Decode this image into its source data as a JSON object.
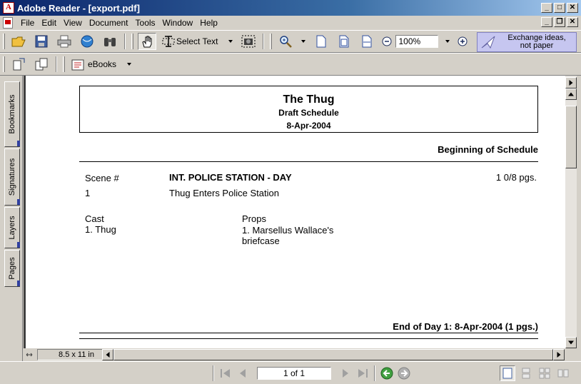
{
  "window": {
    "title": "Adobe Reader - [export.pdf]",
    "controls": {
      "minimize": "_",
      "maximize": "□",
      "close": "✕",
      "restore": "❐"
    }
  },
  "menu": {
    "items": [
      {
        "label": "File"
      },
      {
        "label": "Edit"
      },
      {
        "label": "View"
      },
      {
        "label": "Document"
      },
      {
        "label": "Tools"
      },
      {
        "label": "Window"
      },
      {
        "label": "Help"
      }
    ]
  },
  "toolbar": {
    "select_text_label": "Select Text",
    "zoom_value": "100%",
    "exchange_line1": "Exchange ideas,",
    "exchange_line2": "not paper",
    "ebooks_label": "eBooks"
  },
  "nav_tabs": [
    {
      "label": "Bookmarks"
    },
    {
      "label": "Signatures"
    },
    {
      "label": "Layers"
    },
    {
      "label": "Pages"
    }
  ],
  "document": {
    "title": "The Thug",
    "subtitle": "Draft Schedule",
    "date": "8-Apr-2004",
    "beginning": "Beginning of Schedule",
    "scene_label": "Scene #",
    "scene_heading": "INT. POLICE STATION - DAY",
    "pages": "1 0/8 pgs.",
    "scene_number": "1",
    "scene_description": "Thug Enters Police Station",
    "cast_label": "Cast",
    "cast_item": "1. Thug",
    "props_label": "Props",
    "props_item_line1": "1. Marsellus Wallace's",
    "props_item_line2": "briefcase",
    "end_of_day": "End of Day 1: 8-Apr-2004 (1 pgs.)"
  },
  "status": {
    "page_size": "8.5 x 11 in",
    "page_indicator": "1 of 1"
  },
  "scroll": {
    "vertical_position": 0,
    "horizontal_position": 0
  }
}
